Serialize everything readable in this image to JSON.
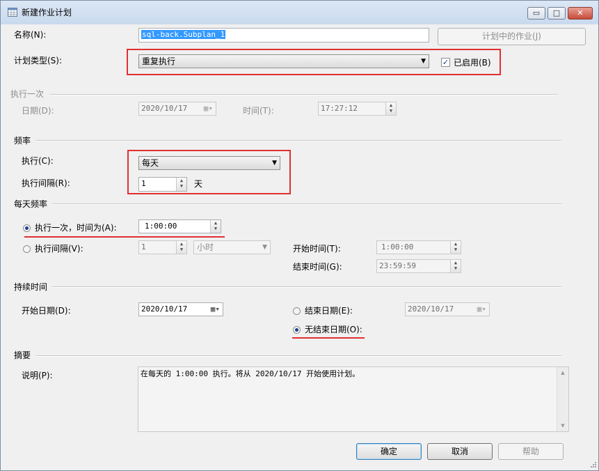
{
  "window": {
    "title": "新建作业计划",
    "controls": {
      "minimize": "▭",
      "maximize": "□",
      "close": "✕"
    },
    "close_color": "#c74b3b"
  },
  "name": {
    "label": "名称(N):",
    "value": "sql-back.Subplan_1"
  },
  "jobs_button": "计划中的作业(J)",
  "schedule_type": {
    "label": "计划类型(S):",
    "value": "重复执行",
    "enabled_label": "已启用(B)",
    "enabled": true
  },
  "one_time": {
    "section": "执行一次",
    "date_label": "日期(D):",
    "date_value": "2020/10/17",
    "time_label": "时间(T):",
    "time_value": "17:27:12"
  },
  "frequency": {
    "section": "频率",
    "occurs_label": "执行(C):",
    "occurs_value": "每天",
    "recurs_label": "执行间隔(R):",
    "recurs_value": "1",
    "recurs_unit": "天"
  },
  "daily_frequency": {
    "section": "每天频率",
    "once_label": "执行一次，时间为(A):",
    "once_time": "1:00:00",
    "once_selected": true,
    "every_label": "执行间隔(V):",
    "every_value": "1",
    "every_unit": "小时",
    "start_label": "开始时间(T):",
    "start_value": "1:00:00",
    "end_label": "结束时间(G):",
    "end_value": "23:59:59"
  },
  "duration": {
    "section": "持续时间",
    "start_label": "开始日期(D):",
    "start_value": "2020/10/17",
    "end_label": "结束日期(E):",
    "end_value": "2020/10/17",
    "no_end_label": "无结束日期(O):",
    "no_end_selected": true
  },
  "summary": {
    "section": "摘要",
    "desc_label": "说明(P):",
    "desc_text": "在每天的 1:00:00 执行。将从 2020/10/17 开始使用计划。"
  },
  "buttons": {
    "ok": "确定",
    "cancel": "取消",
    "help": "帮助"
  },
  "colors": {
    "highlight": "#e03030",
    "selection": "#3399ff"
  }
}
